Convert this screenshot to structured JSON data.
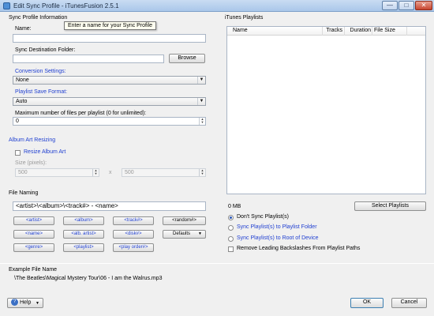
{
  "window": {
    "title": "Edit Sync Profile - iTunesFusion 2.5.1",
    "minimize": "—",
    "maximize": "□",
    "close": "✕"
  },
  "sync_profile": {
    "group_title": "Sync Profile Information",
    "name_label": "Name:",
    "name_value": "",
    "name_tooltip": "Enter a name for your Sync Profile",
    "dest_label": "Sync Destination Folder:",
    "dest_value": "",
    "browse_label": "Browse",
    "conversion_label": "Conversion Settings:",
    "conversion_value": "None",
    "playlist_format_label": "Playlist Save Format:",
    "playlist_format_value": "Auto",
    "max_files_label": "Maximum number of files per playlist (0 for unlimited):",
    "max_files_value": "0"
  },
  "album_art": {
    "group_title": "Album Art Resizing",
    "resize_label": "Resize Album Art",
    "size_label": "Size (pixels):",
    "width_value": "500",
    "x_sep": "x",
    "height_value": "500"
  },
  "file_naming": {
    "group_title": "File Naming",
    "pattern": "<artist>\\<album>\\<track#> - <name>",
    "tokens_row1": [
      "<artist>",
      "<album>",
      "<track#>",
      "<random#>"
    ],
    "tokens_row2": [
      "<name>",
      "<alb. artist>",
      "<disk#>"
    ],
    "defaults_label": "Defaults",
    "tokens_row3": [
      "<genre>",
      "<playlist>",
      "<play order#>"
    ]
  },
  "example": {
    "group_title": "Example File Name",
    "value": "\\The Beatles\\Magical Mystery Tour\\06 - I am the Walrus.mp3"
  },
  "playlists": {
    "group_title": "iTunes Playlists",
    "columns": [
      "Name",
      "Tracks",
      "Duration",
      "File Size"
    ],
    "size_total": "0 MB",
    "select_button": "Select Playlists",
    "options": [
      {
        "label": "Don't Sync Playlist(s)",
        "checked": true
      },
      {
        "label": "Sync Playlist(s) to Playlist Folder",
        "checked": false
      },
      {
        "label": "Sync Playlist(s) to Root of Device",
        "checked": false
      }
    ],
    "remove_backslashes_label": "Remove Leading Backslashes From Playlist Paths"
  },
  "footer": {
    "help_label": "Help",
    "ok_label": "OK",
    "cancel_label": "Cancel"
  },
  "icons": {
    "dropdown": "▼",
    "spin_up": "▲",
    "spin_down": "▼",
    "help": "?"
  }
}
